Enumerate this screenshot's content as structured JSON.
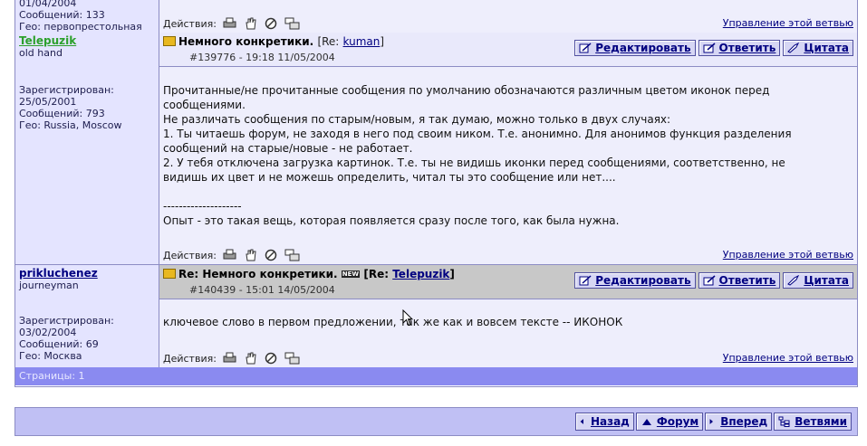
{
  "prev_post": {
    "author_info": [
      "01/04/2004",
      "Сообщений: 133",
      "Гео: первопрестольная"
    ],
    "actions_label": "Действия:",
    "manage_link": "Управление этой ветвью"
  },
  "posts": [
    {
      "author": "Telepuzik",
      "rank": "old hand",
      "registered_label": "Зарегистрирован:",
      "registered_date": "25/05/2001",
      "messages": "Сообщений: 793",
      "geo": "Гео: Russia, Moscow",
      "subject": "Немного конкретики.",
      "re_prefix": "[Re:",
      "re_user": "kuman",
      "re_suffix": "]",
      "post_id": "#139776 - 19:18 11/05/2004",
      "body": "Прочитанные/не прочитанные сообщения по умолчанию обозначаются различным цветом иконок перед\nсообщениями.\nНе различать сообщения по старым/новым, я так думаю, можно только в двух случаях:\n1. Ты читаешь форум, не заходя в него под своим ником. Т.е. анонимно. Для анонимов функция разделения\nсообщений на старые/новые - не работает.\n2. У тебя отключена загрузка картинок. Т.е. ты не видишь иконки перед сообщениями, соответственно, не\nвидишь их цвет и не можешь определить, читал ты это сообщение или нет....\n\n--------------------\nОпыт - это такая вещь, которая появляется сразу после того, как была нужна.",
      "actions_label": "Действия:",
      "manage_link": "Управление этой ветвью"
    },
    {
      "author": "prikluchenez",
      "rank": "journeyman",
      "registered_label": "Зарегистрирован:",
      "registered_date": "03/02/2004",
      "messages": "Сообщений: 69",
      "geo": "Гео: Москва",
      "subject": "Re: Немного конкретики.",
      "new_badge": "NEW",
      "re_prefix": "[Re:",
      "re_user": "Telepuzik",
      "re_suffix": "]",
      "post_id": "#140439 - 15:01 14/05/2004",
      "body": "ключевое слово в первом предложении, так же как и вовсем тексте -- ИКОНОК",
      "actions_label": "Действия:",
      "manage_link": "Управление этой ветвью"
    }
  ],
  "buttons": {
    "edit": "Редактировать",
    "reply": "Ответить",
    "quote": "Цитата"
  },
  "pages_label": "Страницы: 1",
  "nav": {
    "back": "Назад",
    "forum": "Форум",
    "forward": "Вперед",
    "threaded": "Ветвями"
  },
  "colors": {
    "author_active": "#2ca02c",
    "link": "#000080",
    "pages_bar": "#8a8af0"
  }
}
